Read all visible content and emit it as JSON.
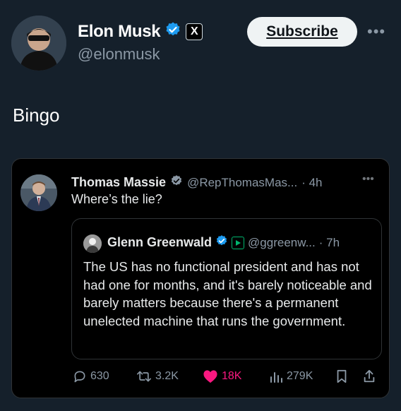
{
  "post": {
    "author_name": "Elon Musk",
    "author_handle": "@elonmusk",
    "x_badge": "X",
    "subscribe_label": "Subscribe",
    "more": "•••",
    "text": "Bingo"
  },
  "quote": {
    "author_name": "Thomas Massie",
    "author_handle": "@RepThomasMas...",
    "time": "· 4h",
    "more": "•••",
    "text": "Where’s the lie?",
    "inner": {
      "author_name": "Glenn Greenwald",
      "author_handle": "@ggreenw...",
      "time": "· 7h",
      "text": "The US has no functional president and has not had one for months, and it's barely noticeable and barely matters because there's a permanent unelected machine that runs the government."
    },
    "actions": {
      "replies": "630",
      "reposts": "3.2K",
      "likes": "18K",
      "views": "279K"
    }
  },
  "colors": {
    "background": "#15202b",
    "verified": "#1d9bf0",
    "like": "#f91880",
    "muted": "#8b98a5"
  }
}
